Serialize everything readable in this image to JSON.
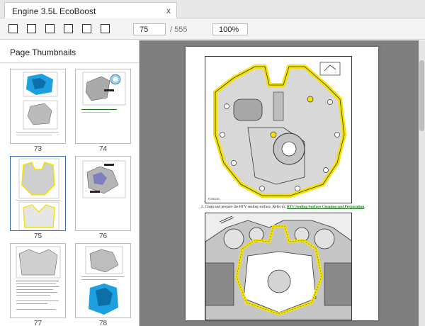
{
  "tab": {
    "title": "Engine 3.5L EcoBoost",
    "close_label": "x"
  },
  "toolbar": {
    "buttons": [
      "square-icon",
      "square-icon",
      "square-icon",
      "square-icon",
      "square-icon",
      "square-icon"
    ],
    "page_value": "75",
    "page_total": "/ 555",
    "zoom_value": "100%"
  },
  "sidebar": {
    "title": "Page Thumbnails",
    "thumbnails": [
      {
        "label": "73"
      },
      {
        "label": "74"
      },
      {
        "label": "75",
        "selected": true
      },
      {
        "label": "76"
      },
      {
        "label": "77"
      },
      {
        "label": "78"
      }
    ]
  },
  "document": {
    "figure1_id": "E298181",
    "step_text": "2. Clean and prepare the RTV sealing surface. Refer to:",
    "step_link": "RTV Sealing Surface Cleaning and Preparation",
    "step_end": "."
  },
  "colors": {
    "sealant": "#f4e300",
    "selection": "#3a6fb3",
    "link": "#1a7a1a",
    "engine_blue": "#1ea0e0",
    "viewer_bg": "#7f7f7f"
  }
}
